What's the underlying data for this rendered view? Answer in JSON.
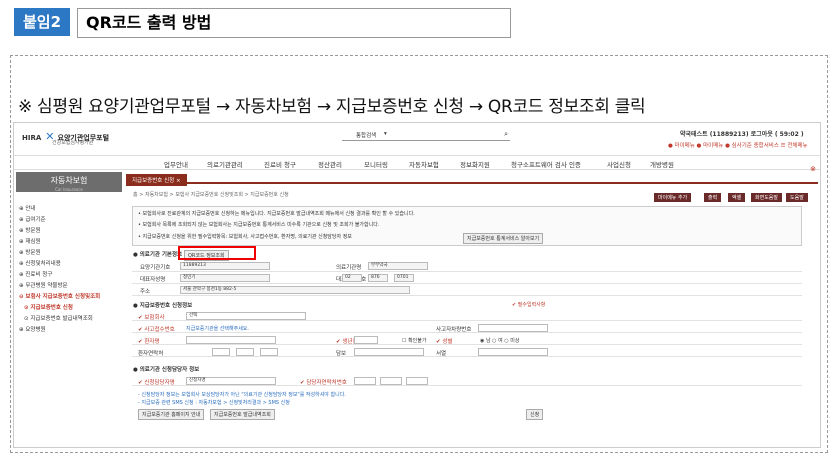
{
  "header": {
    "badge": "붙임2",
    "title": "QR코드 출력 방법"
  },
  "instruction": "※ 심평원 요양기관업무포털 → 자동차보험 → 지급보증번호 신청 → QR코드 정보조회   클릭",
  "portal": {
    "logo": "HIRA",
    "logo_name": "요양기관업무포털",
    "logo_sub": "건강보험심사평가원",
    "search_select": "통합검색",
    "user": "약국테스트 (11889213)  로그아웃  ( 59:02 )",
    "top_links": "● 마이메뉴  ● 마이메뉴  ● 심사기준 종합서비스  ☰ 전체메뉴",
    "nav": [
      "업무안내",
      "의료기관관리",
      "진료비 청구",
      "정산관리",
      "모니터링",
      "자동차보험",
      "정보화지원",
      "청구소프트웨어 검사 인증",
      "사업신청",
      "개방병원"
    ],
    "side_title": "자동차보험",
    "side_sub": "Car Insurance",
    "side_items": [
      "안내",
      "급여기준",
      "방문원",
      "재심원",
      "방문원",
      "신청및처리내용",
      "진료비 청구",
      "무관병원 약물방문",
      "보험사 지급보증번호 신청및조회",
      "지급보증번호 신청",
      "지급보증번호 발급내역조회",
      "요양병원"
    ],
    "tab": "지급보증번호 신청  ×",
    "breadcrumb": "홈 > 자동차보험 > 보험사 지급보증번호 신청및조회 > 지급보증번호 신청",
    "toolbar": [
      "마이메뉴 추가",
      "출력",
      "엑셀",
      "화면도움말",
      "도움말"
    ],
    "info": [
      "• 보험회사로 진료관계의 지급보증번호 신청하는 메뉴입니다. 지급보증번호 발급내역조회 메뉴에서 신청 결과를 확인 할 수 있습니다.",
      "• 보험회사 목록에 조회되지 않는 보험회사는 지급보증번호 통계서비스 미수록 기관으로 신청 및 조회가 불가합니다.",
      "• 지급보증번호 신청을 위한 필수입력항목: 보험회사, 사고접수번호, 환자명, 의료기관 신청담당자 정보"
    ],
    "info_btn": "지급보증번호 통계서비스 알아보기",
    "sec1": "● 의료기관 기본정보",
    "qr_btn": "QR코드 정보조회",
    "inst": {
      "l1": "요양기관기호",
      "v1": "11889213",
      "l2": "의료기관명",
      "v2": "부부약국",
      "l3": "대표자성명",
      "v3": "정민기",
      "l4": "대표전화번호",
      "v4a": "02",
      "v4b": "876",
      "v4c": "0701",
      "l5": "주소",
      "v5": "서울 관악구 봉천1동 882-5"
    },
    "sec2": "● 지급보증번호 신청정보",
    "required": "✔ 필수입력사항",
    "app": {
      "insurer": "✔ 보험회사",
      "insurer_val": "선택",
      "accno": "✔ 사고접수번호",
      "accno_ph": "지급보증기관을 선택해주세요.",
      "vehicle": "사고자차량번호",
      "patient": "✔ 환자명",
      "birth": "✔ 생년월일",
      "idck": "확인불가",
      "sex": "✔ 성별",
      "sex_opts": "◉ 남   ○ 여   ○ 미상",
      "phone": "환자연락처",
      "relation": "담보",
      "etc": "서열"
    },
    "sec3": "● 의료기관 신청담당자 정보",
    "mgr": {
      "name": "✔ 신청담당자명",
      "name_val": "신청자명",
      "tel": "✔ 담당자연락처번호"
    },
    "notes": [
      "- 신청담당자 정보는 보험회사 보상담당자가 아닌 \"의료기관 신청담당자 정보\"를 작성하셔야 합니다.",
      "- 지급보증 관련 SMS 신청 : 자동차보험 > 신청및처리결과 > SMS 신청"
    ],
    "bottom_btns": [
      "지급보증기관 홈페이지 안내",
      "지급보증번호 발급내역조회"
    ],
    "submit": "신청"
  }
}
